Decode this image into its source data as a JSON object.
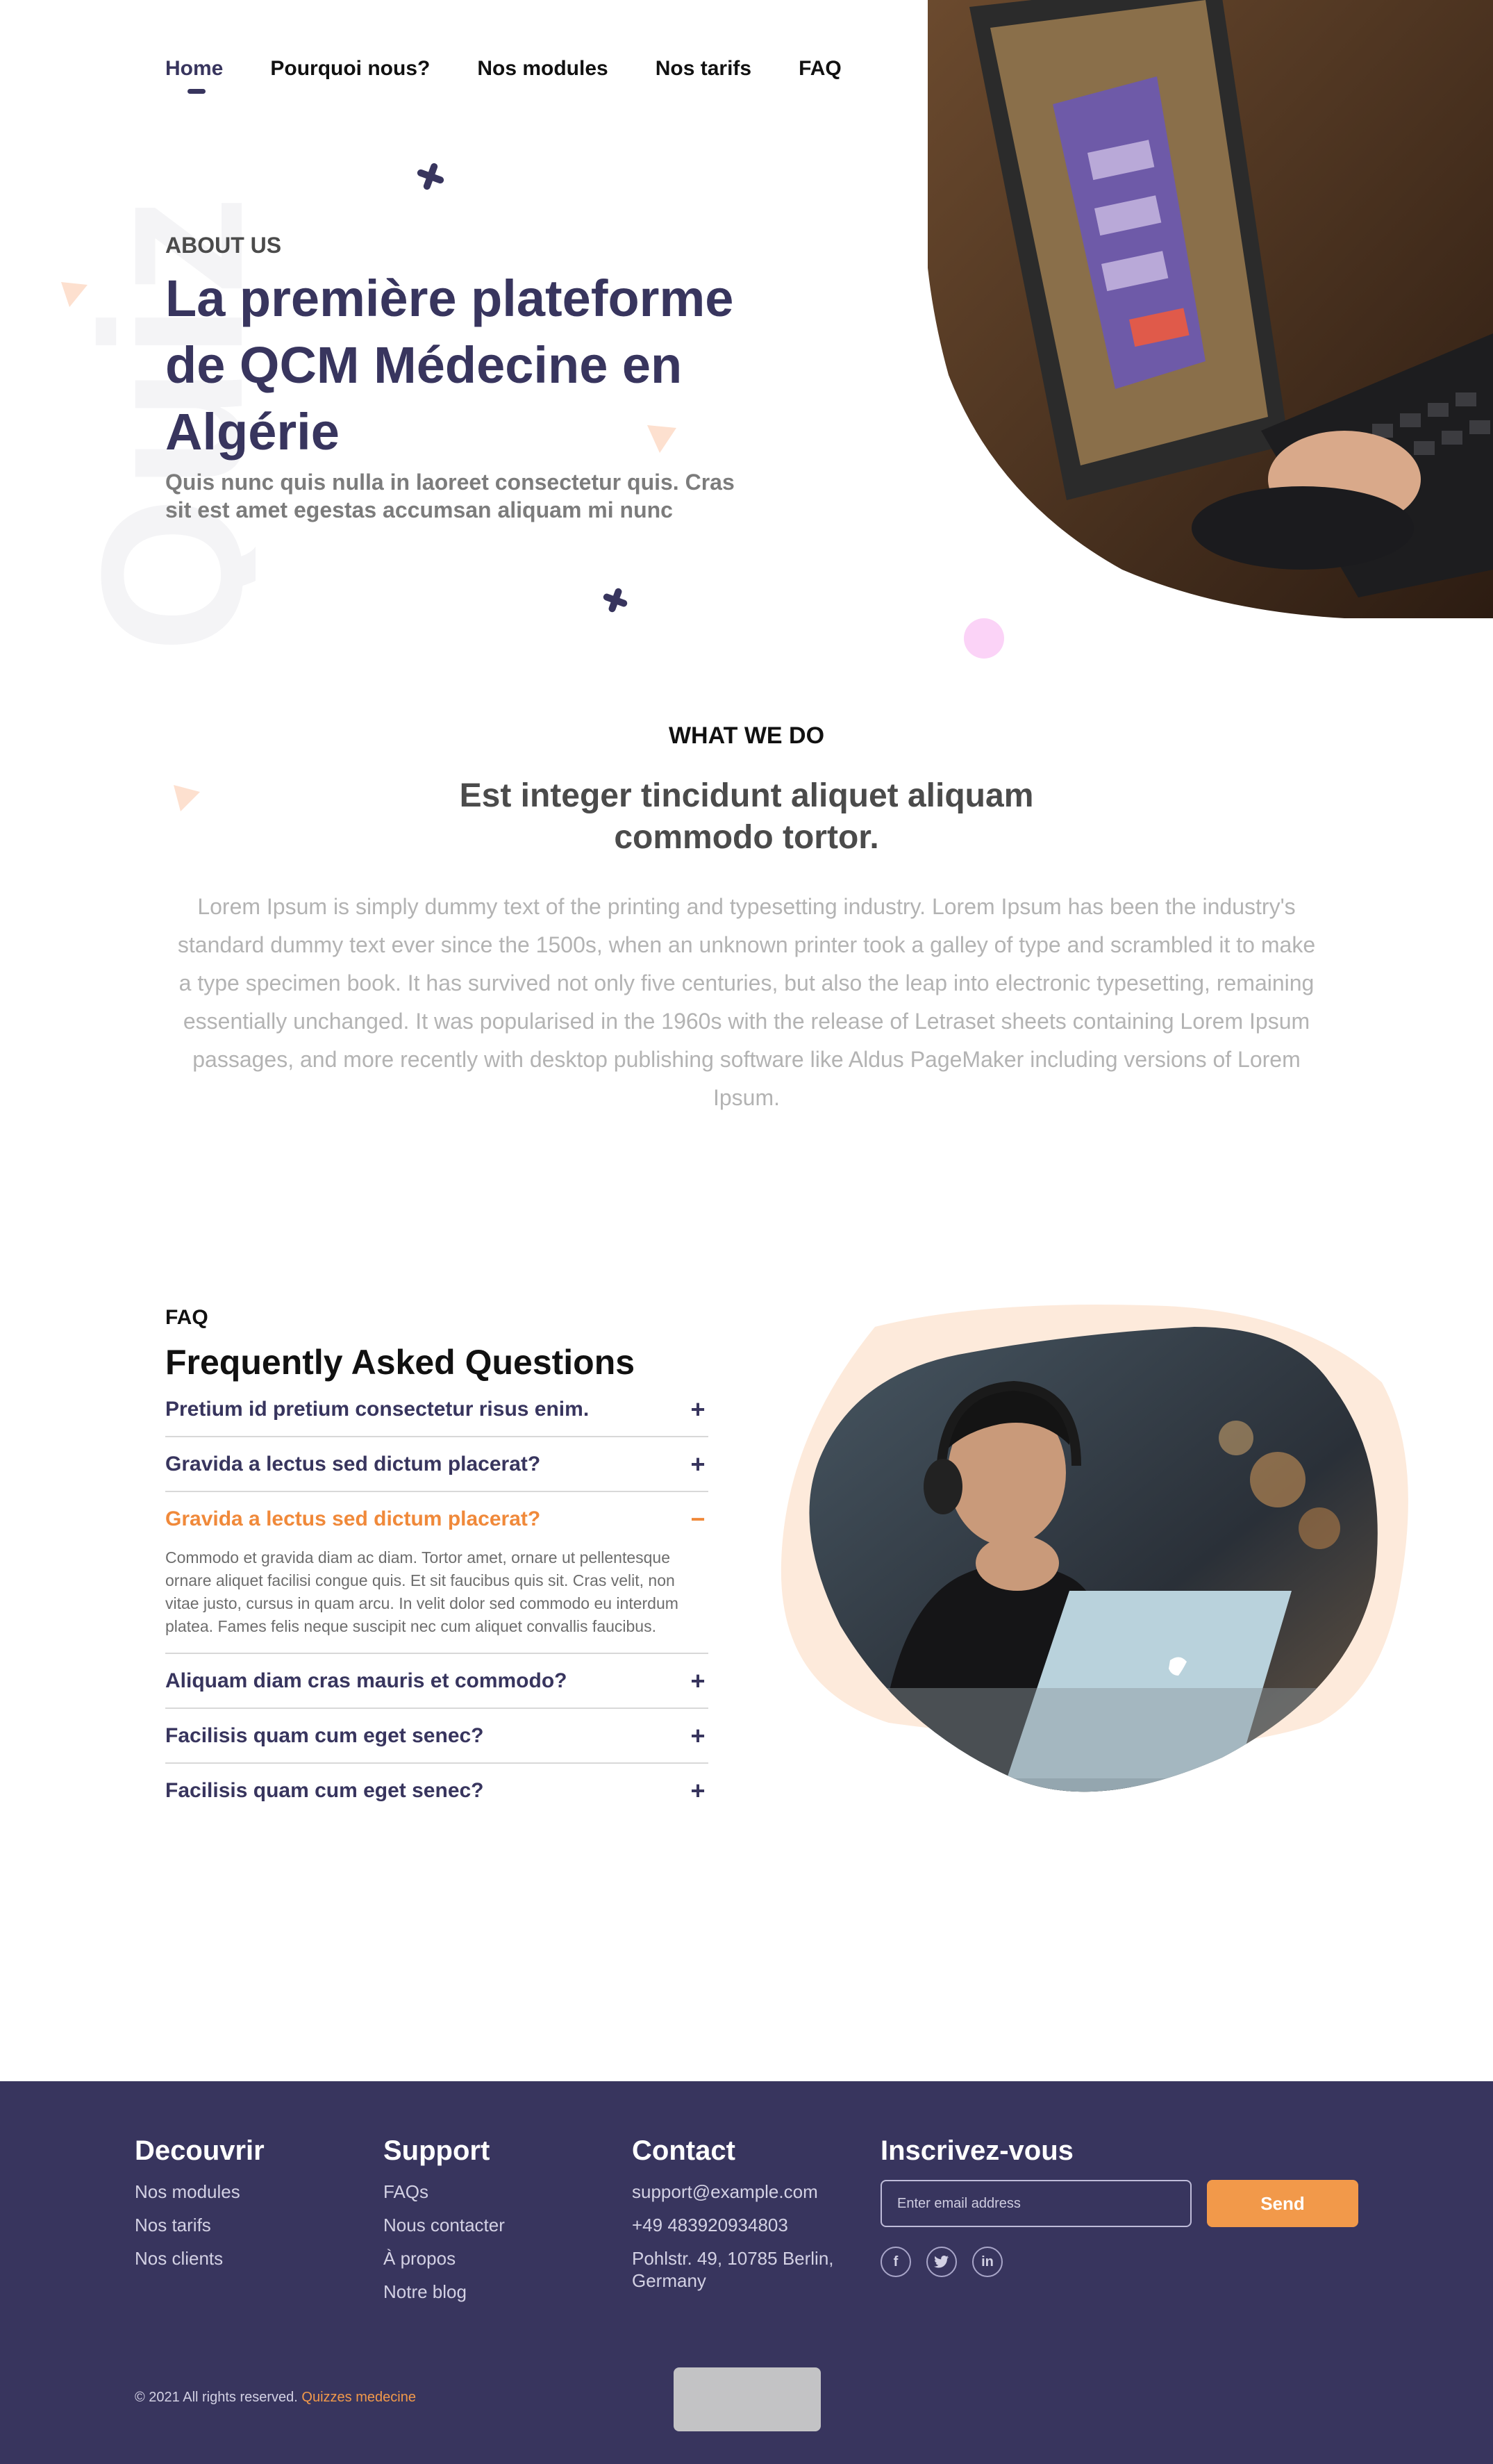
{
  "nav": {
    "items": [
      {
        "label": "Home",
        "active": true
      },
      {
        "label": "Pourquoi nous?",
        "active": false
      },
      {
        "label": "Nos modules",
        "active": false
      },
      {
        "label": "Nos tarifs",
        "active": false
      },
      {
        "label": "FAQ",
        "active": false
      }
    ]
  },
  "hero": {
    "background_word": "Quiz",
    "eyebrow": "ABOUT US",
    "title": "La première plateforme de QCM Médecine en Algérie",
    "subtitle": "Quis nunc quis nulla in laoreet consectetur quis. Cras sit est amet egestas accumsan aliquam mi nunc",
    "image_subject": "laptop-quiz-screen-photo"
  },
  "what_we_do": {
    "eyebrow": "WHAT WE DO",
    "title": "Est integer tincidunt aliquet aliquam commodo tortor.",
    "body": "Lorem Ipsum is simply dummy text of the printing and typesetting industry. Lorem Ipsum has been the industry's standard dummy text ever since the 1500s, when an unknown printer took a galley of type and scrambled it to make a type specimen book. It has survived not only five centuries, but also the leap into electronic typesetting, remaining essentially unchanged. It was popularised in the 1960s with the release of Letraset sheets containing Lorem Ipsum passages, and more recently with desktop publishing software like Aldus PageMaker including versions of Lorem Ipsum."
  },
  "faq": {
    "eyebrow": "FAQ",
    "title": "Frequently Asked Questions",
    "items": [
      {
        "question": "Pretium id pretium consectetur risus enim.",
        "toggle": "+",
        "open": false
      },
      {
        "question": "Gravida a lectus sed dictum placerat?",
        "toggle": "+",
        "open": false
      },
      {
        "question": "Gravida a lectus sed dictum placerat?",
        "toggle": "−",
        "open": true,
        "answer": "Commodo et gravida diam ac diam. Tortor amet, ornare ut pellentesque ornare aliquet facilisi congue quis. Et sit faucibus quis sit. Cras velit, non vitae justo, cursus in quam arcu. In velit dolor sed commodo eu interdum platea. Fames felis neque suscipit nec cum aliquet convallis faucibus."
      },
      {
        "question": "Aliquam diam cras mauris et commodo?",
        "toggle": "+",
        "open": false
      },
      {
        "question": "Facilisis quam cum eget senec?",
        "toggle": "+",
        "open": false
      },
      {
        "question": "Facilisis quam cum eget senec?",
        "toggle": "+",
        "open": false
      }
    ],
    "image_subject": "man-with-headphones-laptop-photo"
  },
  "footer": {
    "discover": {
      "title": "Decouvrir",
      "links": [
        "Nos modules",
        "Nos tarifs",
        "Nos clients"
      ]
    },
    "support": {
      "title": "Support",
      "links": [
        "FAQs",
        "Nous contacter",
        "À propos",
        "Notre blog"
      ]
    },
    "contact": {
      "title": "Contact",
      "email": "support@example.com",
      "phone": "+49 483920934803",
      "address": "Pohlstr. 49, 10785 Berlin, Germany"
    },
    "newsletter": {
      "title": "Inscrivez-vous",
      "placeholder": "Enter email address",
      "button": "Send"
    },
    "socials": [
      {
        "icon": "facebook-icon",
        "glyph": "f"
      },
      {
        "icon": "twitter-icon",
        "glyph": "t"
      },
      {
        "icon": "linkedin-icon",
        "glyph": "in"
      }
    ],
    "copyright": "© 2021 All rights reserved.",
    "brand": "Quizzes medecine"
  },
  "colors": {
    "primary": "#38355e",
    "accent": "#f2994a",
    "accent_text": "#f0893a",
    "pink_dot": "#fbd3f7",
    "peach_blob": "#fdeadb"
  }
}
